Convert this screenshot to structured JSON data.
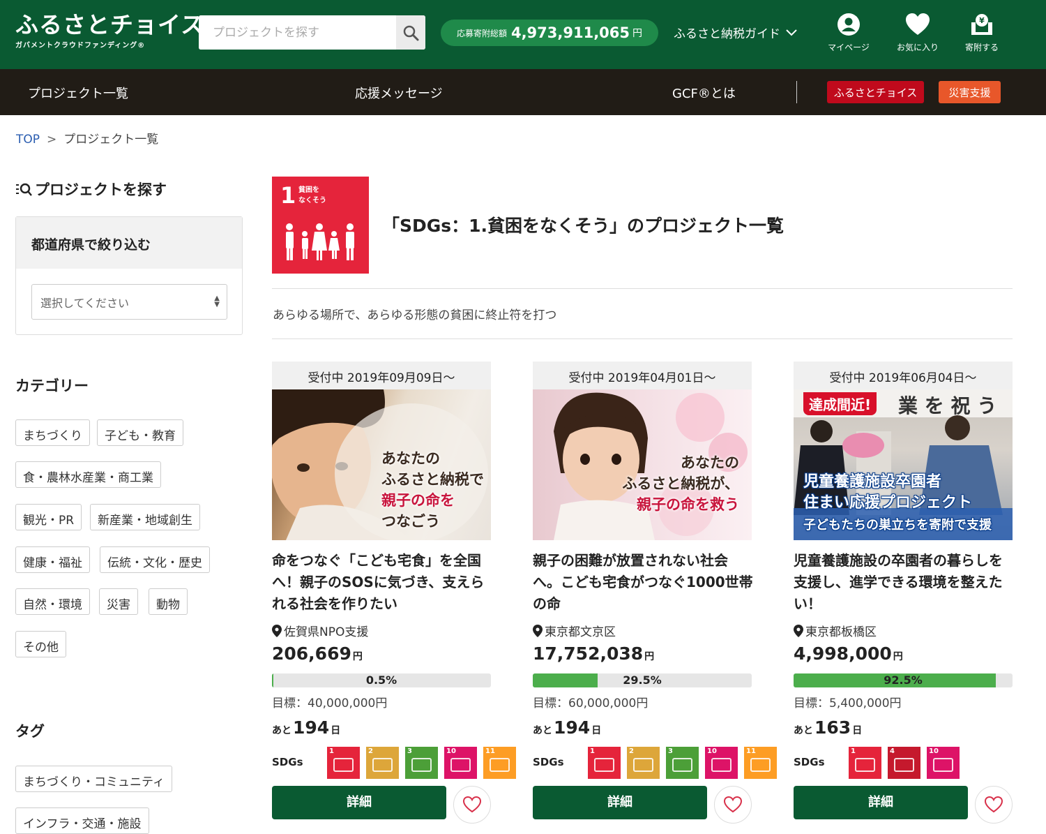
{
  "header": {
    "logo_main": "ふるさとチョイス",
    "logo_sub": "ガバメントクラウドファンディング®",
    "search_placeholder": "プロジェクトを探す",
    "total_label": "応募寄附総額",
    "total_amount": "4,973,911,065",
    "total_unit": "円",
    "guide_label": "ふるさと納税ガイド",
    "icons": [
      {
        "name": "user-icon",
        "label": "マイページ"
      },
      {
        "name": "heart-icon",
        "label": "お気に入り"
      },
      {
        "name": "donate-icon",
        "label": "寄附する"
      }
    ]
  },
  "nav": {
    "links": [
      "プロジェクト一覧",
      "応援メッセージ",
      "GCF®とは"
    ],
    "btn_choice": "ふるさとチョイス",
    "btn_choice_color": "#c00a1c",
    "btn_disaster": "災害支援",
    "btn_disaster_color": "#e8572a"
  },
  "breadcrumb": {
    "top": "TOP",
    "sep": ">",
    "current": "プロジェクト一覧"
  },
  "sidebar": {
    "title": "プロジェクトを探す",
    "pref_title": "都道府県で絞り込む",
    "pref_placeholder": "選択してください",
    "category_title": "カテゴリー",
    "categories": [
      "まちづくり",
      "子ども・教育",
      "食・農林水産業・商工業",
      "観光・PR",
      "新産業・地域創生",
      "健康・福祉",
      "伝統・文化・歴史",
      "自然・環境",
      "災害",
      "動物",
      "その他"
    ],
    "tag_title": "タグ",
    "tags": [
      "まちづくり・コミュニティ",
      "インフラ・交通・施設"
    ]
  },
  "main": {
    "sdg_number": "1",
    "sdg_logo_text": "貧困を\nなくそう",
    "sdg_color": "#e5243b",
    "title": "「SDGs：1.貧困をなくそう」のプロジェクト一覧",
    "description": "あらゆる場所で、あらゆる形態の貧困に終止符を打つ"
  },
  "cards": [
    {
      "date": "受付中 2019年09月09日〜",
      "overlay": [
        "あなたの",
        "ふるさと納税で",
        "親子の命を",
        "つなごう"
      ],
      "title": "命をつなぐ「こども宅食」を全国へ！親子のSOSに気づき、支えられる社会を作りたい",
      "location": "佐賀県NPO支援",
      "amount": "206,669",
      "yen": "円",
      "progress_pct": 0.5,
      "progress_label": "0.5%",
      "goal": "目標：40,000,000円",
      "days_prefix": "あと",
      "days": "194",
      "days_suffix": "日",
      "sdgs_label": "SDGs",
      "sdgs": [
        {
          "n": "1",
          "color": "#e5243b"
        },
        {
          "n": "2",
          "color": "#dda63a"
        },
        {
          "n": "3",
          "color": "#4c9f38"
        },
        {
          "n": "10",
          "color": "#dd1367"
        },
        {
          "n": "11",
          "color": "#fd9d24"
        }
      ],
      "detail_label": "詳細"
    },
    {
      "date": "受付中 2019年04月01日〜",
      "overlay": [
        "あなたの",
        "ふるさと納税が、",
        "親子の命を救う"
      ],
      "title": "親子の困難が放置されない社会へ。こども宅食がつなぐ1000世帯の命",
      "location": "東京都文京区",
      "amount": "17,752,038",
      "yen": "円",
      "progress_pct": 29.5,
      "progress_label": "29.5%",
      "goal": "目標：60,000,000円",
      "days_prefix": "あと",
      "days": "194",
      "days_suffix": "日",
      "sdgs_label": "SDGs",
      "sdgs": [
        {
          "n": "1",
          "color": "#e5243b"
        },
        {
          "n": "2",
          "color": "#dda63a"
        },
        {
          "n": "3",
          "color": "#4c9f38"
        },
        {
          "n": "10",
          "color": "#dd1367"
        },
        {
          "n": "11",
          "color": "#fd9d24"
        }
      ],
      "detail_label": "詳細"
    },
    {
      "date": "受付中 2019年06月04日〜",
      "badge": "達成間近!",
      "banner_top": "業 を 祝 う",
      "overlay": [
        "児童養護施設卒園者",
        "住まい応援プロジェクト"
      ],
      "overlay_sub": "子どもたちの巣立ちを寄附で支援",
      "title": "児童養護施設の卒園者の暮らしを支援し、進学できる環境を整えたい！",
      "location": "東京都板橋区",
      "amount": "4,998,000",
      "yen": "円",
      "progress_pct": 92.5,
      "progress_label": "92.5%",
      "goal": "目標：5,400,000円",
      "days_prefix": "あと",
      "days": "163",
      "days_suffix": "日",
      "sdgs_label": "SDGs",
      "sdgs": [
        {
          "n": "1",
          "color": "#e5243b"
        },
        {
          "n": "4",
          "color": "#c5192d"
        },
        {
          "n": "10",
          "color": "#dd1367"
        }
      ],
      "detail_label": "詳細"
    }
  ]
}
